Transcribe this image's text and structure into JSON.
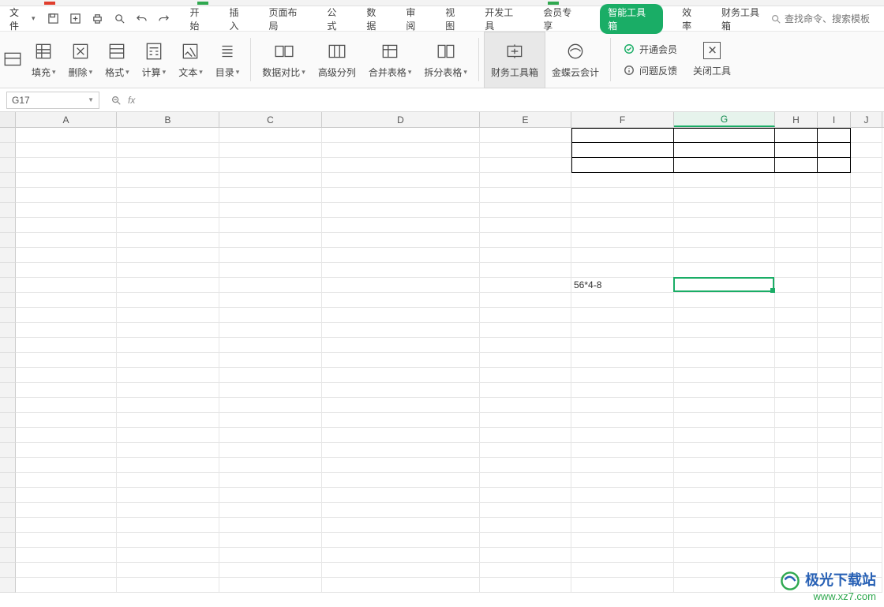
{
  "menubar": {
    "file_label": "文件",
    "tabs": [
      "开始",
      "插入",
      "页面布局",
      "公式",
      "数据",
      "审阅",
      "视图",
      "开发工具",
      "会员专享"
    ],
    "pill": "智能工具箱",
    "extra_tabs": [
      "效率",
      "财务工具箱"
    ],
    "search_placeholder": "查找命令、搜索模板"
  },
  "ribbon": {
    "buttons": {
      "fill": "填充",
      "delete": "删除",
      "format": "格式",
      "calc": "计算",
      "text": "文本",
      "toc": "目录",
      "compare": "数据对比",
      "advsplit": "高级分列",
      "merge": "合并表格",
      "split": "拆分表格",
      "fintool": "财务工具箱",
      "kingdee": "金蝶云会计"
    },
    "links": {
      "member": "开通会员",
      "feedback": "问题反馈"
    },
    "close": "关闭工具"
  },
  "formula": {
    "name": "G17",
    "fx": "fx",
    "value": ""
  },
  "columns": [
    "A",
    "B",
    "C",
    "D",
    "E",
    "F",
    "G",
    "H",
    "I",
    "J"
  ],
  "cells": {
    "F11": "56*4-8"
  },
  "selected_cell": {
    "col": "G",
    "row_index": 10
  },
  "watermark": {
    "line1": "极光下载站",
    "line2": "www.xz7.com"
  }
}
